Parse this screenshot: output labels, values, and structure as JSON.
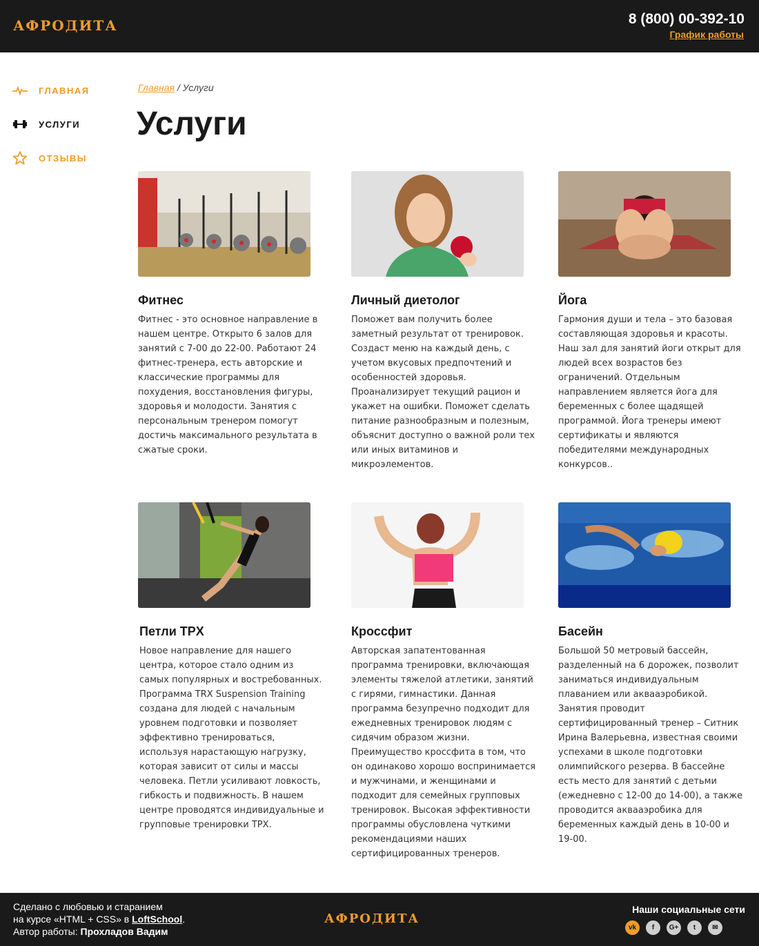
{
  "header": {
    "logo": "АФРОДИТА",
    "phone": "8 (800) 00-392-10",
    "schedule_link": "График работы"
  },
  "sidebar": {
    "items": [
      {
        "label": "ГЛАВНАЯ",
        "icon": "pulse-icon",
        "active": false
      },
      {
        "label": "УСЛУГИ",
        "icon": "dumbbell-icon",
        "active": true
      },
      {
        "label": "ОТЗЫВЫ",
        "icon": "star-icon",
        "active": false
      }
    ]
  },
  "breadcrumb": {
    "home": "Главная",
    "separator": " / ",
    "current": "Услуги"
  },
  "page_title": "Услуги",
  "services": [
    {
      "title": "Фитнес",
      "image": "gym-bikes-photo",
      "text": "Фитнес - это основное направление в нашем центре. Открыто 6 залов для занятий с 7-00 до 22-00. Работают 24 фитнес-тренера, есть авторские и классические программы для похудения, восстановления фигуры, здоровья и молодости. Занятия с персональным тренером помогут достичь максимального результата в сжатые сроки."
    },
    {
      "title": "Личный диетолог",
      "image": "woman-apple-photo",
      "text": "Поможет вам получить более заметный результат от тренировок. Создаст меню на каждый день, с учетом вкусовых предпочтений и особенностей здоровья. Проанализирует текущий рацион и укажет на ошибки. Поможет сделать питание разнообразным и полезным, объяснит доступно о важной роли тех или иных витаминов и микроэлементов."
    },
    {
      "title": "Йога",
      "image": "yoga-stretch-photo",
      "text": "Гармония души и тела – это базовая составляющая здоровья и красоты. Наш зал для занятий йоги открыт для людей всех возрастов без ограничений. Отдельным направлением является йога для беременных с более щадящей программой. Йога тренеры имеют сертификаты и являются победителями международных конкурсов.."
    },
    {
      "title": "Петли TPX",
      "image": "trx-straps-photo",
      "text": "Новое направление для нашего центра, которое стало одним из самых популярных и востребованных. Программа TRX Suspension Training создана для людей с начальным уровнем подготовки и позволяет эффективно тренироваться, используя нарастающую нагрузку, которая зависит от силы и массы человека. Петли усиливают ловкость, гибкость и подвижность. В нашем центре проводятся индивидуальные и групповые тренировки TPX."
    },
    {
      "title": "Кроссфит",
      "image": "crossfit-woman-photo",
      "text": "Авторская запатентованная программа тренировки, включающая элементы тяжелой атлетики, занятий с гирями, гимнастики. Данная программа безупречно подходит для ежедневных тренировок людям с сидячим образом жизни. Преимущество кроссфита в том, что он одинаково хорошо воспринимается и мужчинами, и женщинами и подходит для семейных групповых тренировок. Высокая эффективности программы обусловлена чуткими рекомендациями наших сертифицированных тренеров."
    },
    {
      "title": "Басейн",
      "image": "swimmer-pool-photo",
      "text": "Большой 50 метровый бассейн, разделенный на 6 дорожек, позволит заниматься индивидуальным плаванием или аквааэробикой. Занятия проводит сертифицированный тренер – Ситник Ирина Валерьевна, известная своими успехами в школе подготовки олимпийского резерва. В бассейне есть место для занятий с детьми (ежедневно с 12-00 до 14-00), а также проводится аквааэробика для беременных каждый день в 10-00 и 19-00."
    }
  ],
  "footer": {
    "line1": "Сделано с любовью и старанием",
    "line2_prefix": "на курсе «HTML + CSS» в ",
    "line2_link": "LoftSchool",
    "line2_suffix": ".",
    "line3_prefix": "Автор работы: ",
    "author": "Прохладов Вадим",
    "logo": "АФРОДИТА",
    "social_title": "Наши социальные сети",
    "social": [
      {
        "icon": "vk-icon",
        "glyph": "vk"
      },
      {
        "icon": "facebook-icon",
        "glyph": "f"
      },
      {
        "icon": "google-plus-icon",
        "glyph": "G+"
      },
      {
        "icon": "twitter-icon",
        "glyph": "t"
      },
      {
        "icon": "mail-icon",
        "glyph": "✉"
      }
    ]
  },
  "colors": {
    "accent": "#f29c2b",
    "dark": "#1a1a1a"
  }
}
